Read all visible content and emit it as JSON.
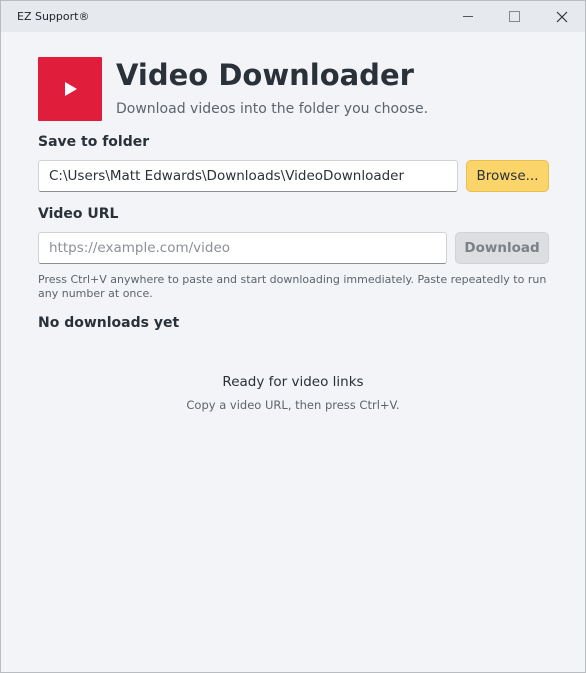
{
  "window": {
    "title": "EZ Support®",
    "controls": [
      "minimize-icon",
      "maximize-icon",
      "close-icon"
    ]
  },
  "header": {
    "logo_icon": "play-icon",
    "title": "Video Downloader",
    "subtitle": "Download videos into the folder you choose.",
    "accent": "#e11d3c"
  },
  "folder": {
    "label": "Save to folder",
    "value": "C:\\Users\\Matt Edwards\\Downloads\\VideoDownloader",
    "browse_label": "Browse..."
  },
  "url": {
    "label": "Video URL",
    "placeholder": "https://example.com/video",
    "download_label": "Download",
    "hint": "Press Ctrl+V anywhere to paste and start downloading immediately. Paste repeatedly to run any number at once."
  },
  "downloads": {
    "heading": "No downloads yet",
    "empty_title": "Ready for video links",
    "empty_subtitle": "Copy a video URL, then press Ctrl+V."
  }
}
